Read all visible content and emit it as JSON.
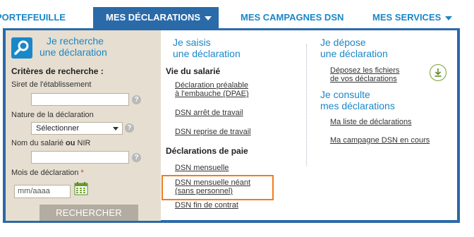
{
  "nav": {
    "tabs": [
      {
        "label": "PORTEFEUILLE"
      },
      {
        "label": "MES DÉCLARATIONS"
      },
      {
        "label": "MES CAMPAGNES DSN"
      },
      {
        "label": "MES SERVICES"
      }
    ]
  },
  "search": {
    "title_line1": "Je recherche",
    "title_line2": "une déclaration",
    "criteria_label": "Critères de recherche :",
    "siret_label": "Siret de l'établissement",
    "siret_value": "",
    "nature_label": "Nature de la déclaration",
    "nature_selected": "Sélectionner",
    "name_label_a": "Nom du salarié ",
    "name_label_or": "ou",
    "name_label_b": " NIR",
    "name_value": "",
    "month_label": "Mois de déclaration ",
    "month_required": "*",
    "month_placeholder": "mm/aaaa",
    "help_glyph": "?",
    "button_label": "RECHERCHER"
  },
  "middle": {
    "title_line1": "Je saisis",
    "title_line2": "une déclaration",
    "section1": "Vie du salarié",
    "dpae_line1": "Déclaration préalable",
    "dpae_line2": "à l'embauche (DPAE)",
    "dsn_arret": "DSN arrêt de travail",
    "dsn_reprise": "DSN reprise de travail",
    "section2": "Déclarations de paie",
    "dsn_mensuelle": "DSN mensuelle",
    "dsn_neant_line1": "DSN mensuelle néant",
    "dsn_neant_line2": "(sans personnel)",
    "dsn_fin": "DSN fin de contrat"
  },
  "right": {
    "depose_line1": "Je dépose",
    "depose_line2": "une déclaration",
    "deposez_line1": "Déposez les fichiers",
    "deposez_line2": "de vos déclarations",
    "consulte_line1": "Je consulte",
    "consulte_line2": "mes déclarations",
    "ma_liste": "Ma liste de déclarations",
    "ma_campagne": "Ma campagne DSN en cours"
  },
  "colors": {
    "brand_blue": "#1a87c8",
    "nav_active": "#2a6aa8",
    "panel_bg": "#e6ded0",
    "highlight": "#f07c1e"
  },
  "icons": [
    "search-icon",
    "chevron-down-icon",
    "help-icon",
    "calendar-icon",
    "download-icon"
  ]
}
